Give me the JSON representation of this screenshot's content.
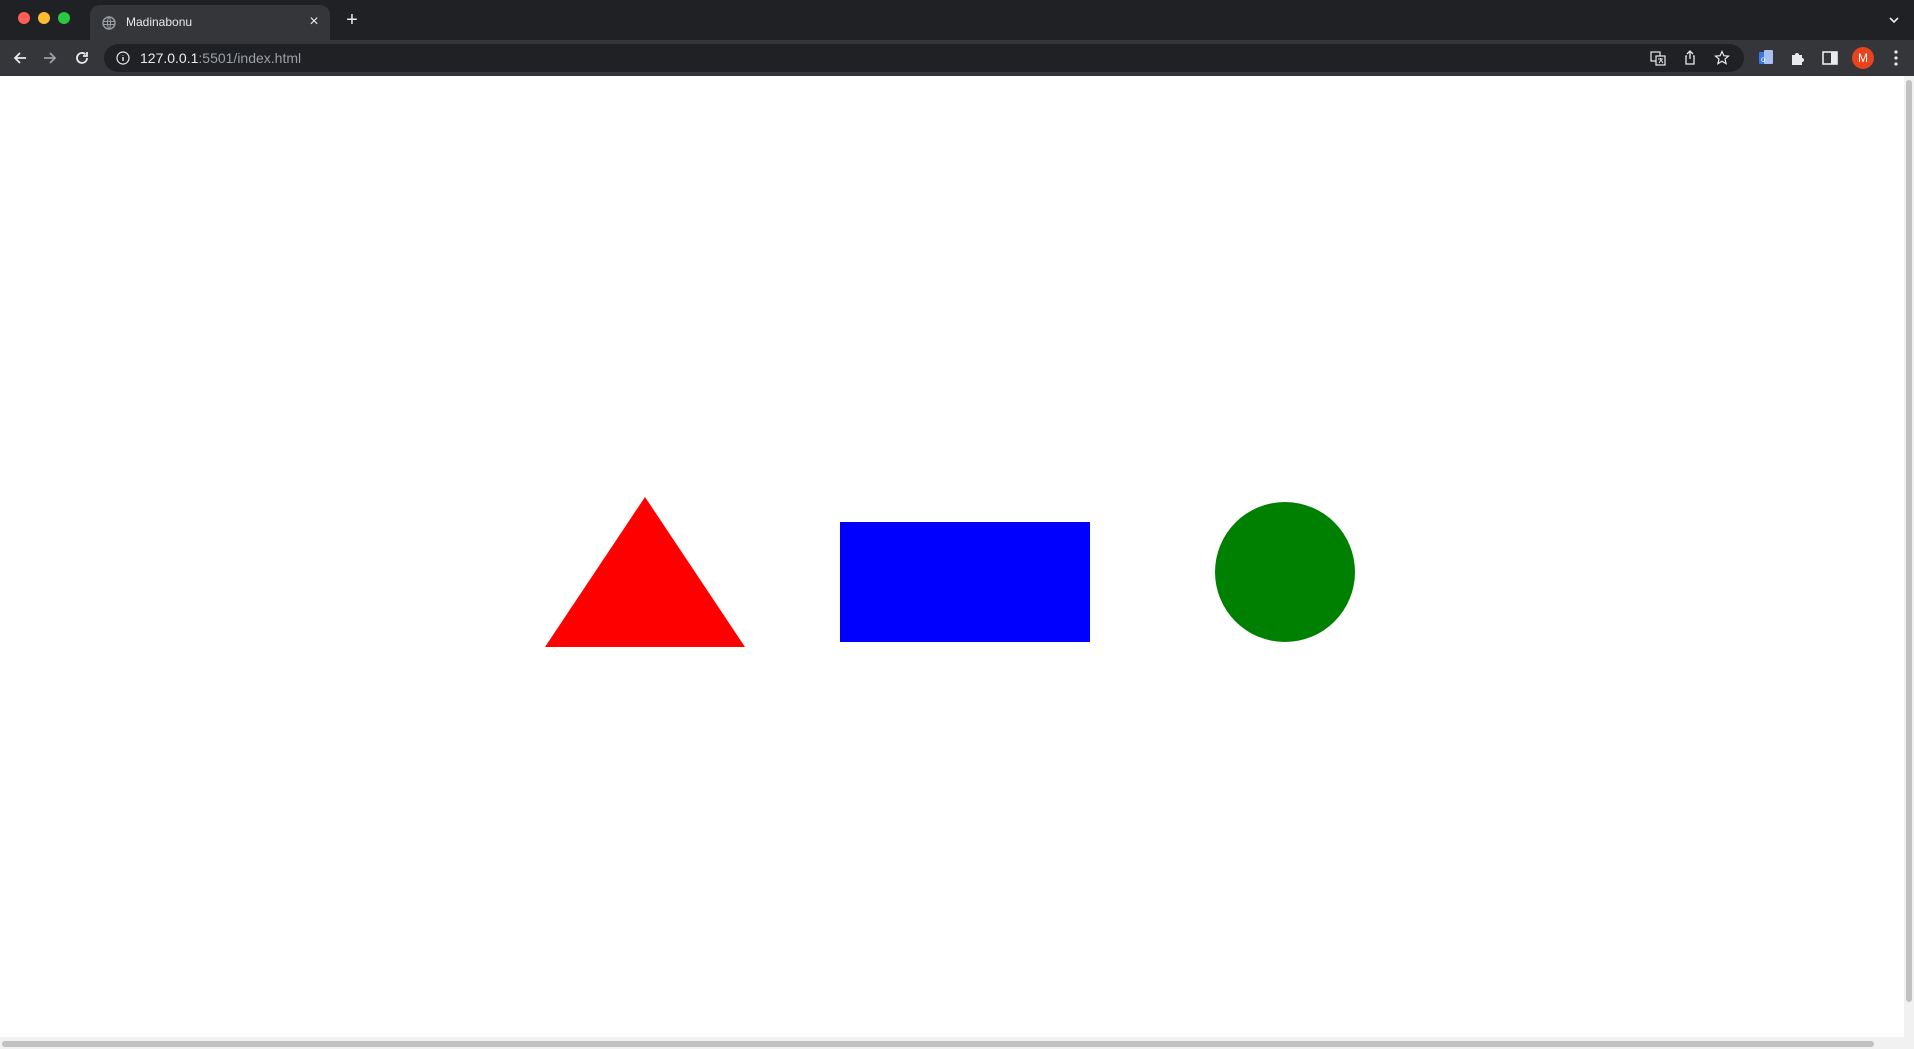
{
  "browser": {
    "tab": {
      "title": "Madinabonu",
      "favicon": "globe-icon",
      "close": "×"
    },
    "new_tab": "+",
    "address": {
      "host": "127.0.0.1",
      "rest": ":5501/index.html"
    },
    "profile_initial": "M",
    "icons": [
      "back-icon",
      "forward-icon",
      "reload-icon",
      "info-icon",
      "translate-icon",
      "share-icon",
      "star-icon",
      "extension-icon",
      "puzzle-icon",
      "side-panel-icon",
      "more-menu-icon",
      "tab-search-icon"
    ]
  },
  "page": {
    "shapes": [
      {
        "kind": "triangle",
        "color": "#ff0000"
      },
      {
        "kind": "rectangle",
        "color": "#0000ff"
      },
      {
        "kind": "circle",
        "color": "#008000"
      }
    ]
  },
  "colors": {
    "chrome_dark": "#202124",
    "chrome_mid": "#35363a",
    "avatar": "#e8431d"
  }
}
